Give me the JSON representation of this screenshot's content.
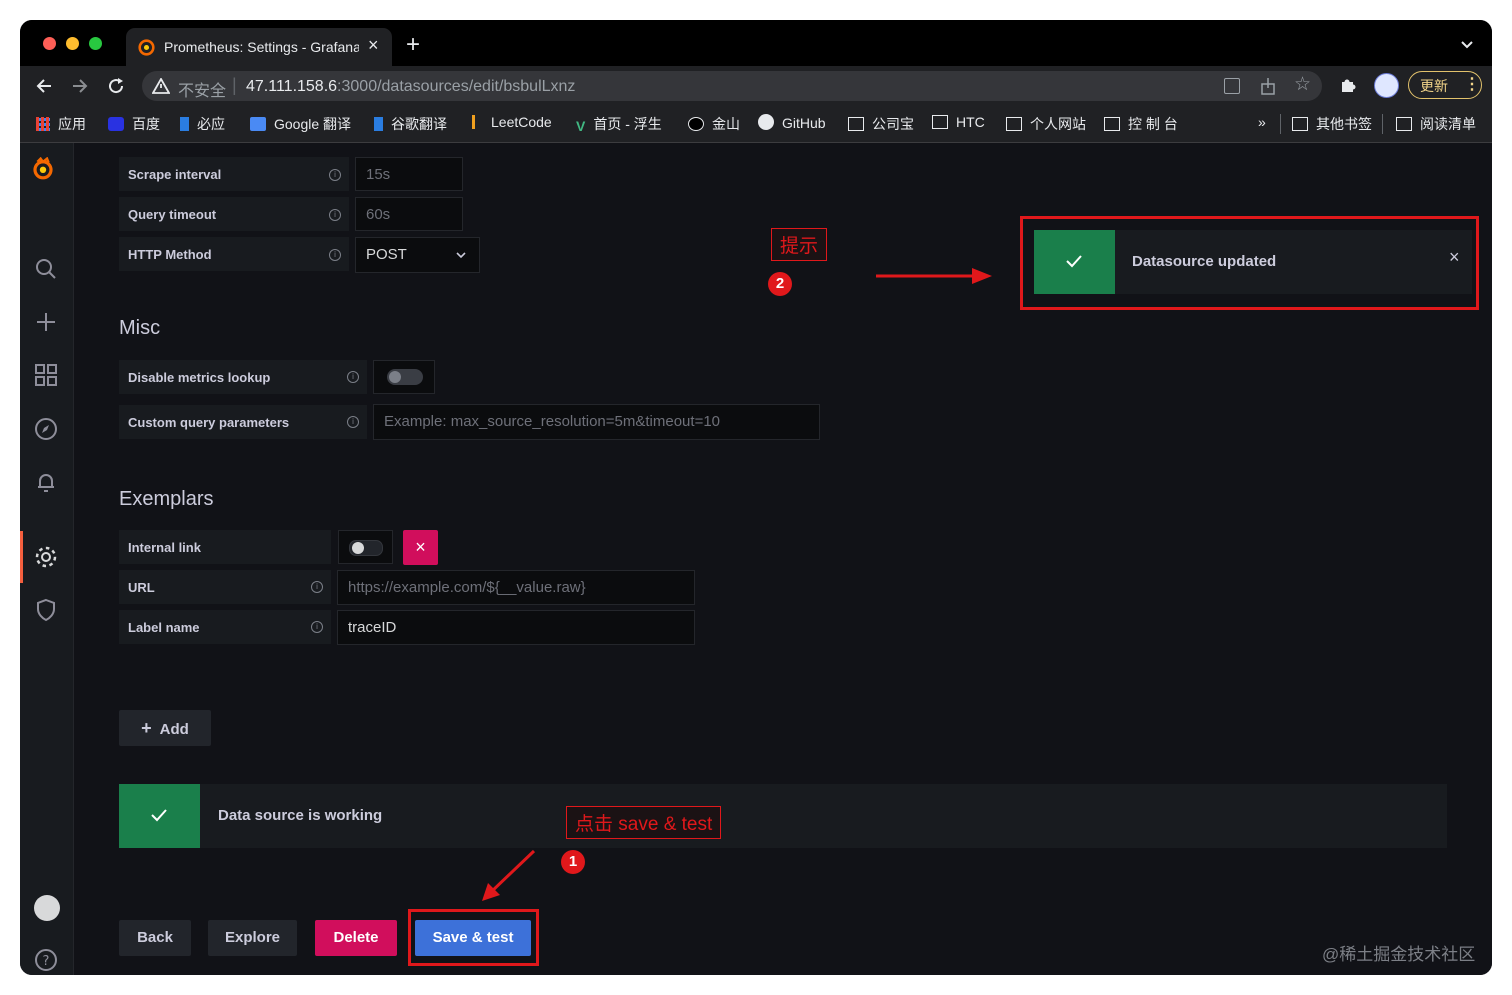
{
  "browser": {
    "tab_title": "Prometheus: Settings - Grafana",
    "new_tab": "+",
    "security_label": "不安全",
    "url_host": "47.111.158.6",
    "url_rest": ":3000/datasources/edit/bsbulLxnz",
    "update_label": "更新",
    "bookmarks": [
      {
        "label": "应用",
        "icon": "apps-grid-icon"
      },
      {
        "label": "百度",
        "icon": "baidu-icon"
      },
      {
        "label": "必应",
        "icon": "bing-icon"
      },
      {
        "label": "Google 翻译",
        "icon": "google-translate-icon"
      },
      {
        "label": "谷歌翻译",
        "icon": "bing-icon"
      },
      {
        "label": "LeetCode",
        "icon": "leetcode-icon"
      },
      {
        "label": "首页 - 浮生",
        "icon": "vue-icon"
      },
      {
        "label": "金山",
        "icon": "kingsoft-icon"
      },
      {
        "label": "GitHub",
        "icon": "github-icon"
      },
      {
        "label": "公司宝",
        "icon": "folder-icon"
      },
      {
        "label": "HTC",
        "icon": "folder-icon"
      },
      {
        "label": "个人网站",
        "icon": "folder-icon"
      },
      {
        "label": "控 制 台",
        "icon": "folder-icon"
      }
    ],
    "overflow": "»",
    "other_bookmarks": "其他书签",
    "reading_list": "阅读清单"
  },
  "form": {
    "scrape_interval": {
      "label": "Scrape interval",
      "value": "15s"
    },
    "query_timeout": {
      "label": "Query timeout",
      "value": "60s"
    },
    "http_method": {
      "label": "HTTP Method",
      "value": "POST"
    },
    "misc_title": "Misc",
    "disable_metrics": {
      "label": "Disable metrics lookup",
      "enabled": false
    },
    "custom_query": {
      "label": "Custom query parameters",
      "placeholder": "Example: max_source_resolution=5m&timeout=10"
    },
    "exemplars_title": "Exemplars",
    "internal_link": {
      "label": "Internal link",
      "enabled": false
    },
    "url": {
      "label": "URL",
      "placeholder": "https://example.com/${__value.raw}"
    },
    "label_name": {
      "label": "Label name",
      "value": "traceID"
    },
    "add_label": "Add"
  },
  "alerts": {
    "working": "Data source is working",
    "toast": "Datasource updated"
  },
  "buttons": {
    "back": "Back",
    "explore": "Explore",
    "delete": "Delete",
    "save_test": "Save & test"
  },
  "annotations": {
    "hint": "提示",
    "hint_num": "2",
    "click_save": "点击 save & test",
    "click_num": "1"
  },
  "watermark": "@稀土掘金技术社区",
  "colors": {
    "success": "#1a7f4b",
    "delete": "#d10e5c",
    "primary": "#3d71d9",
    "annotation": "#e0181b"
  }
}
